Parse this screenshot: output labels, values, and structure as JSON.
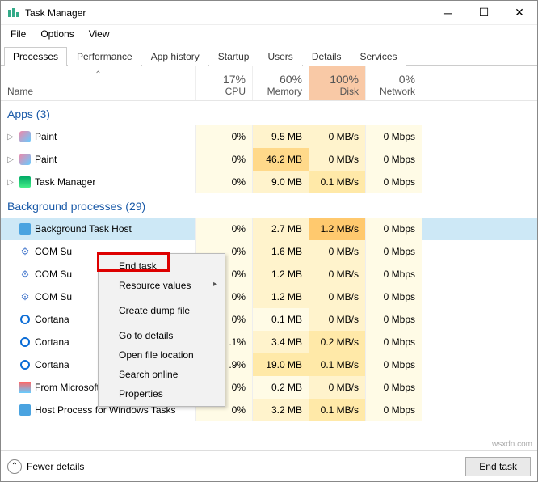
{
  "window": {
    "title": "Task Manager"
  },
  "menu": {
    "file": "File",
    "options": "Options",
    "view": "View"
  },
  "tabs": {
    "processes": "Processes",
    "performance": "Performance",
    "apphistory": "App history",
    "startup": "Startup",
    "users": "Users",
    "details": "Details",
    "services": "Services"
  },
  "header": {
    "name": "Name",
    "cpu": {
      "pct": "17%",
      "label": "CPU"
    },
    "memory": {
      "pct": "60%",
      "label": "Memory"
    },
    "disk": {
      "pct": "100%",
      "label": "Disk"
    },
    "network": {
      "pct": "0%",
      "label": "Network"
    }
  },
  "sections": {
    "apps": "Apps (3)",
    "bg": "Background processes (29)"
  },
  "rows": {
    "apps": [
      {
        "name": "Paint",
        "icon": "paint",
        "cpu": "0%",
        "mem": "9.5 MB",
        "disk": "0 MB/s",
        "net": "0 Mbps"
      },
      {
        "name": "Paint",
        "icon": "paint",
        "cpu": "0%",
        "mem": "46.2 MB",
        "disk": "0 MB/s",
        "net": "0 Mbps"
      },
      {
        "name": "Task Manager",
        "icon": "tm",
        "cpu": "0%",
        "mem": "9.0 MB",
        "disk": "0.1 MB/s",
        "net": "0 Mbps"
      }
    ],
    "bg": [
      {
        "name": "Background Task Host",
        "icon": "host",
        "cpu": "0%",
        "mem": "2.7 MB",
        "disk": "1.2 MB/s",
        "net": "0 Mbps",
        "sel": true
      },
      {
        "name": "COM Su",
        "icon": "gear",
        "cpu": "0%",
        "mem": "1.6 MB",
        "disk": "0 MB/s",
        "net": "0 Mbps"
      },
      {
        "name": "COM Su",
        "icon": "gear",
        "cpu": "0%",
        "mem": "1.2 MB",
        "disk": "0 MB/s",
        "net": "0 Mbps"
      },
      {
        "name": "COM Su",
        "icon": "gear",
        "cpu": "0%",
        "mem": "1.2 MB",
        "disk": "0 MB/s",
        "net": "0 Mbps"
      },
      {
        "name": "Cortana",
        "icon": "cortana",
        "cpu": "0%",
        "mem": "0.1 MB",
        "disk": "0 MB/s",
        "net": "0 Mbps"
      },
      {
        "name": "Cortana",
        "icon": "cortana",
        "cpu": ".1%",
        "mem": "3.4 MB",
        "disk": "0.2 MB/s",
        "net": "0 Mbps"
      },
      {
        "name": "Cortana",
        "icon": "cortana",
        "cpu": ".9%",
        "mem": "19.0 MB",
        "disk": "0.1 MB/s",
        "net": "0 Mbps"
      },
      {
        "name": "From Microsoft Background Ta...",
        "icon": "ms",
        "cpu": "0%",
        "mem": "0.2 MB",
        "disk": "0 MB/s",
        "net": "0 Mbps"
      },
      {
        "name": "Host Process for Windows Tasks",
        "icon": "host",
        "cpu": "0%",
        "mem": "3.2 MB",
        "disk": "0.1 MB/s",
        "net": "0 Mbps"
      }
    ]
  },
  "ctx": {
    "end": "End task",
    "res": "Resource values",
    "dump": "Create dump file",
    "details": "Go to details",
    "open": "Open file location",
    "search": "Search online",
    "props": "Properties"
  },
  "footer": {
    "fewer": "Fewer details",
    "endtask": "End task"
  },
  "watermark": "wsxdn.com",
  "heat": {
    "cpu": {
      "default": "heat0"
    },
    "memory": {
      "9.5 MB": "heat1",
      "46.2 MB": "heat3",
      "9.0 MB": "heat1",
      "2.7 MB": "heat1",
      "1.6 MB": "heat1",
      "1.2 MB": "heat1",
      "0.1 MB": "heat0",
      "3.4 MB": "heat1",
      "19.0 MB": "heat2",
      "0.2 MB": "heat0",
      "3.2 MB": "heat1"
    },
    "disk": {
      "0 MB/s": "heat1",
      "0.1 MB/s": "heat2",
      "1.2 MB/s": "heat4",
      "0.2 MB/s": "heat2"
    },
    "network": {
      "default": "heat0"
    }
  }
}
